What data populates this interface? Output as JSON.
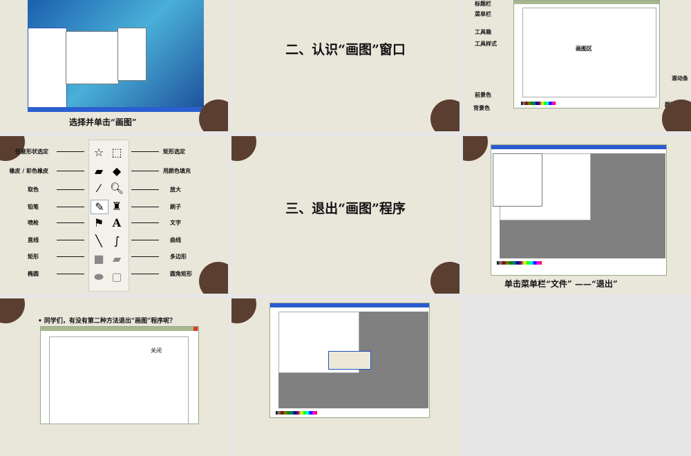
{
  "slides": [
    {
      "caption": "选择并单击“画图”"
    },
    {
      "title": "二、认识“画图”窗口"
    },
    {
      "labels": {
        "title_bar": "标题栏",
        "menu_bar": "菜单栏",
        "toolbox": "工具箱",
        "tool_style": "工具样式",
        "drawing_area": "画图区",
        "scrollbar": "滚动条",
        "foreground": "前景色",
        "background": "背景色",
        "palette": "颜料盒"
      }
    },
    {
      "left": [
        "任意形状选定",
        "橡皮 / 彩色橡皮",
        "取色",
        "铅笔",
        "喷枪",
        "直线",
        "矩形",
        "椭圆"
      ],
      "right": [
        "矩形选定",
        "用颜色填充",
        "放大",
        "刷子",
        "文字",
        "曲线",
        "多边形",
        "圆角矩形"
      ]
    },
    {
      "title": "三、退出“画图”程序"
    },
    {
      "caption": "单击菜单栏“文件” ——“退出”"
    },
    {
      "bullet": "同学们，有没有第二种方法退出“画图”程序呢？",
      "close_label": "关闭"
    },
    {}
  ]
}
